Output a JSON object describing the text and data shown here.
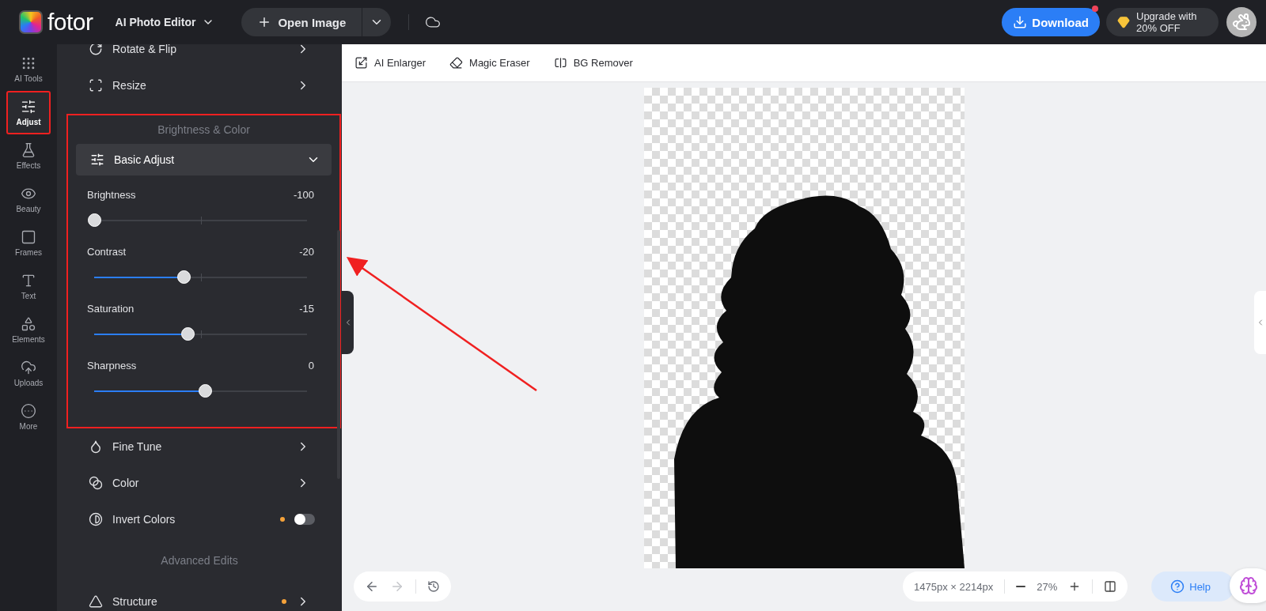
{
  "header": {
    "logo": "fotor",
    "mode": "AI Photo Editor",
    "open_button": "Open Image",
    "download": {
      "label": "Download",
      "notification": true
    },
    "upgrade": "Upgrade with 20% OFF"
  },
  "rail": [
    {
      "kind": "tools",
      "label": "AI Tools",
      "selected": false,
      "highlighted": false
    },
    {
      "kind": "adjust",
      "label": "Adjust",
      "selected": true,
      "highlighted": true
    },
    {
      "kind": "effects",
      "label": "Effects",
      "selected": false,
      "highlighted": false
    },
    {
      "kind": "beauty",
      "label": "Beauty",
      "selected": false,
      "highlighted": false
    },
    {
      "kind": "frames",
      "label": "Frames",
      "selected": false,
      "highlighted": false
    },
    {
      "kind": "text",
      "label": "Text",
      "selected": false,
      "highlighted": false
    },
    {
      "kind": "elements",
      "label": "Elements",
      "selected": false,
      "highlighted": false
    },
    {
      "kind": "uploads",
      "label": "Uploads",
      "selected": false,
      "highlighted": false
    },
    {
      "kind": "more",
      "label": "More",
      "selected": false,
      "highlighted": false
    }
  ],
  "panel": {
    "top_items": [
      {
        "kind": "link",
        "label": "Rotate & Flip"
      },
      {
        "kind": "link",
        "label": "Resize"
      }
    ],
    "section": {
      "title": "Brightness & Color",
      "highlighted": true,
      "group": {
        "title": "Basic Adjust",
        "expanded": true
      },
      "sliders": [
        {
          "name": "Brightness",
          "reading": "-100",
          "level": 0
        },
        {
          "name": "Contrast",
          "reading": "-20",
          "level": 0.42
        },
        {
          "name": "Saturation",
          "reading": "-15",
          "level": 0.44
        },
        {
          "name": "Sharpness",
          "reading": "0",
          "level": 0.52
        }
      ]
    },
    "items": [
      {
        "kind": "link",
        "label": "Fine Tune",
        "dot": false
      },
      {
        "kind": "link",
        "label": "Color",
        "dot": false
      },
      {
        "kind": "toggle",
        "label": "Invert Colors",
        "dot": true,
        "on": false
      }
    ],
    "section2": "Advanced Edits",
    "items2": [
      {
        "kind": "link",
        "label": "Structure",
        "dot": true
      }
    ]
  },
  "toolbar": [
    {
      "kind": "enlarger",
      "label": "AI Enlarger"
    },
    {
      "kind": "eraser",
      "label": "Magic Eraser"
    },
    {
      "kind": "bg",
      "label": "BG Remover"
    }
  ],
  "bottom": {
    "size": "1475px × 2214px",
    "zoom": "27%",
    "help": "Help"
  },
  "annotation_arrow": true
}
